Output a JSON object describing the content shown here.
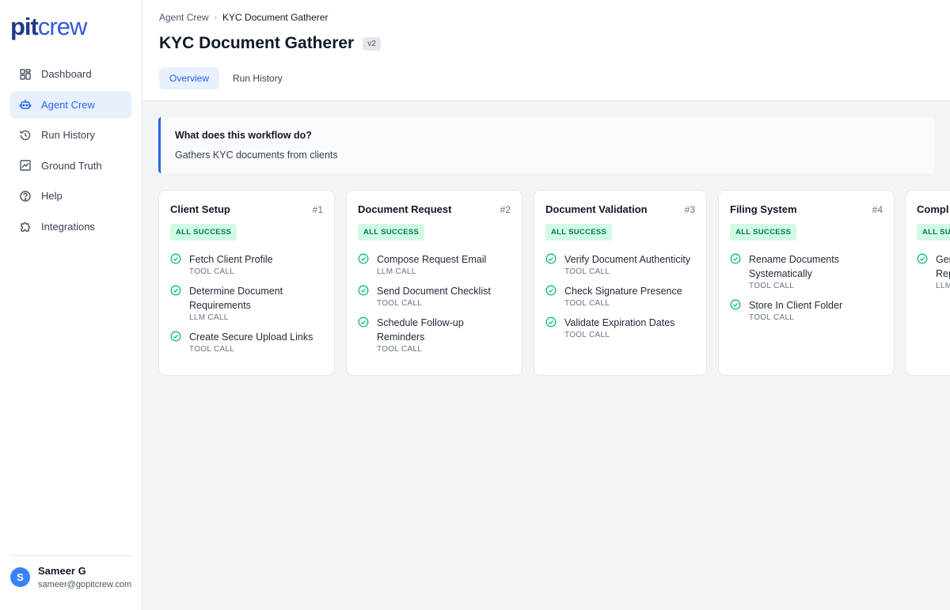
{
  "brand": {
    "pit": "pit",
    "crew": "crew"
  },
  "sidebar": {
    "items": [
      {
        "label": "Dashboard",
        "icon": "dashboard-icon"
      },
      {
        "label": "Agent Crew",
        "icon": "robot-icon"
      },
      {
        "label": "Run History",
        "icon": "history-icon"
      },
      {
        "label": "Ground Truth",
        "icon": "chart-icon"
      },
      {
        "label": "Help",
        "icon": "help-icon"
      },
      {
        "label": "Integrations",
        "icon": "puzzle-icon"
      }
    ],
    "active": "Agent Crew"
  },
  "user": {
    "initial": "S",
    "name": "Sameer G",
    "email": "sameer@gopitcrew.com"
  },
  "breadcrumb": {
    "parent": "Agent Crew",
    "sep": "›",
    "current": "KYC Document Gatherer"
  },
  "page": {
    "title": "KYC Document Gatherer",
    "version": "v2"
  },
  "tabs": [
    {
      "label": "Overview"
    },
    {
      "label": "Run History"
    }
  ],
  "info": {
    "question": "What does this workflow do?",
    "answer": "Gathers KYC documents from clients"
  },
  "colors": {
    "accent": "#2563eb",
    "success_bg": "#d1fae5",
    "success_text": "#047857"
  },
  "cards": [
    {
      "title": "Client Setup",
      "num": "#1",
      "badge": "ALL SUCCESS",
      "steps": [
        {
          "name": "Fetch Client Profile",
          "type": "TOOL CALL"
        },
        {
          "name": "Determine Document Requirements",
          "type": "LLM CALL"
        },
        {
          "name": "Create Secure Upload Links",
          "type": "TOOL CALL"
        }
      ]
    },
    {
      "title": "Document Request",
      "num": "#2",
      "badge": "ALL SUCCESS",
      "steps": [
        {
          "name": "Compose Request Email",
          "type": "LLM CALL"
        },
        {
          "name": "Send Document Checklist",
          "type": "TOOL CALL"
        },
        {
          "name": "Schedule Follow-up Reminders",
          "type": "TOOL CALL"
        }
      ]
    },
    {
      "title": "Document Validation",
      "num": "#3",
      "badge": "ALL SUCCESS",
      "steps": [
        {
          "name": "Verify Document Authenticity",
          "type": "TOOL CALL"
        },
        {
          "name": "Check Signature Presence",
          "type": "TOOL CALL"
        },
        {
          "name": "Validate Expiration Dates",
          "type": "TOOL CALL"
        }
      ]
    },
    {
      "title": "Filing System",
      "num": "#4",
      "badge": "ALL SUCCESS",
      "steps": [
        {
          "name": "Rename Documents Systematically",
          "type": "TOOL CALL"
        },
        {
          "name": "Store In Client Folder",
          "type": "TOOL CALL"
        }
      ]
    },
    {
      "title": "Compl",
      "num": "",
      "badge": "ALL SU",
      "steps": [
        {
          "name": "Ger Rep",
          "type": "LLM"
        }
      ]
    }
  ]
}
